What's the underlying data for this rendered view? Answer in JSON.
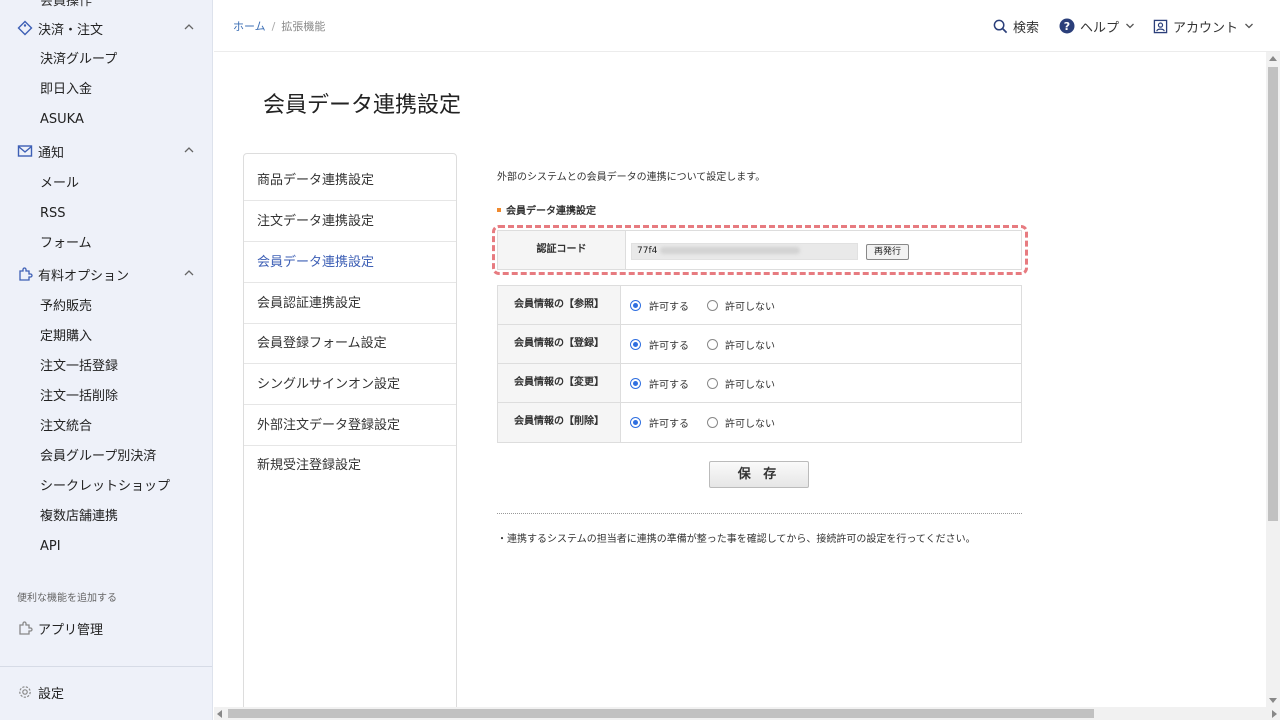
{
  "sidebar": {
    "clipped_item": "会員操作",
    "groups": [
      {
        "label": "決済・注文",
        "icon": "tag-icon",
        "expanded": true,
        "items": [
          "決済グループ",
          "即日入金",
          "ASUKA"
        ]
      },
      {
        "label": "通知",
        "icon": "mail-icon",
        "expanded": true,
        "items": [
          "メール",
          "RSS",
          "フォーム"
        ]
      },
      {
        "label": "有料オプション",
        "icon": "puzzle-icon",
        "expanded": true,
        "items": [
          "予約販売",
          "定期購入",
          "注文一括登録",
          "注文一括削除",
          "注文統合",
          "会員グループ別決済",
          "シークレットショップ",
          "複数店舗連携",
          "API"
        ]
      }
    ],
    "section_label": "便利な機能を追加する",
    "app_management": "アプリ管理",
    "settings": "設定"
  },
  "header": {
    "breadcrumb": {
      "home": "ホーム",
      "separator": "/",
      "current": "拡張機能"
    },
    "search": "検索",
    "help": "ヘルプ",
    "account": "アカウント"
  },
  "page": {
    "title": "会員データ連携設定",
    "subnav": [
      {
        "label": "商品データ連携設定",
        "active": false
      },
      {
        "label": "注文データ連携設定",
        "active": false
      },
      {
        "label": "会員データ連携設定",
        "active": true
      },
      {
        "label": "会員認証連携設定",
        "active": false
      },
      {
        "label": "会員登録フォーム設定",
        "active": false
      },
      {
        "label": "シングルサインオン設定",
        "active": false
      },
      {
        "label": "外部注文データ登録設定",
        "active": false
      },
      {
        "label": "新規受注登録設定",
        "active": false
      }
    ],
    "description": "外部のシステムとの会員データの連携について設定します。",
    "section_title": "会員データ連携設定",
    "auth": {
      "label": "認証コード",
      "value_prefix": "77f4",
      "reissue": "再発行"
    },
    "permissions": [
      {
        "label": "会員情報の【参照】",
        "allow": "許可する",
        "deny": "許可しない",
        "selected": "allow"
      },
      {
        "label": "会員情報の【登録】",
        "allow": "許可する",
        "deny": "許可しない",
        "selected": "allow"
      },
      {
        "label": "会員情報の【変更】",
        "allow": "許可する",
        "deny": "許可しない",
        "selected": "allow"
      },
      {
        "label": "会員情報の【削除】",
        "allow": "許可する",
        "deny": "許可しない",
        "selected": "allow"
      }
    ],
    "save": "保 存",
    "note": "・連携するシステムの担当者に連携の準備が整った事を確認してから、接続許可の設定を行ってください。"
  },
  "colors": {
    "accent_blue": "#3d5fb5",
    "radio_blue": "#2f6fe0",
    "highlight_red": "#e77b80",
    "section_orange": "#ef8a2f",
    "sidebar_bg": "#eef1f9"
  }
}
